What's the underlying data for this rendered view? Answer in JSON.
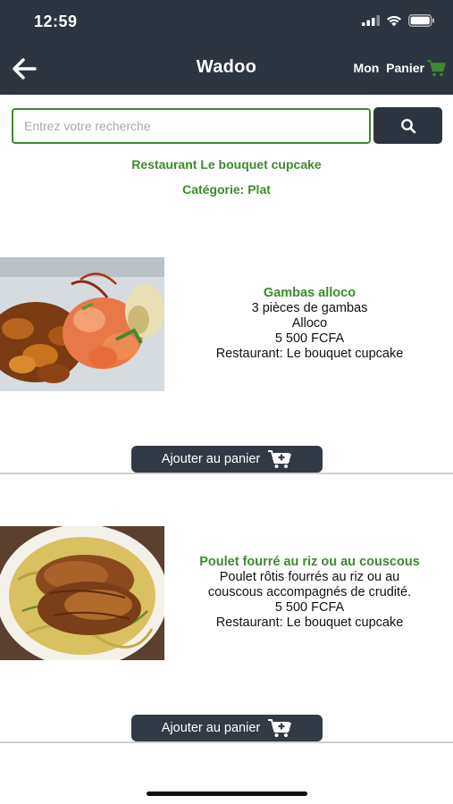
{
  "status": {
    "time": "12:59"
  },
  "nav": {
    "title": "Wadoo",
    "cart_label": "Mon Panier"
  },
  "search": {
    "placeholder": "Entrez votre recherche",
    "value": ""
  },
  "header": {
    "restaurant": "Restaurant Le bouquet cupcake",
    "category": "Catégorie: Plat"
  },
  "products": [
    {
      "name": "Gambas alloco",
      "desc": "3 pièces de gambas\nAlloco",
      "price": "5 500 FCFA",
      "restaurant": "Restaurant: Le bouquet cupcake",
      "button": "Ajouter au panier"
    },
    {
      "name": "Poulet fourré au riz ou au couscous",
      "desc": "Poulet rôtis fourrés au riz ou au\ncouscous accompagnés de crudité.",
      "price": "5 500 FCFA",
      "restaurant": "Restaurant: Le bouquet cupcake",
      "button": "Ajouter au panier"
    }
  ],
  "colors": {
    "nav_bg": "#2c3540",
    "accent_green": "#3c8b2e",
    "button_bg": "#323b45"
  },
  "icons": [
    "back-arrow-icon",
    "cart-icon",
    "search-icon",
    "add-to-cart-icon",
    "signal-icon",
    "wifi-icon",
    "battery-icon"
  ]
}
